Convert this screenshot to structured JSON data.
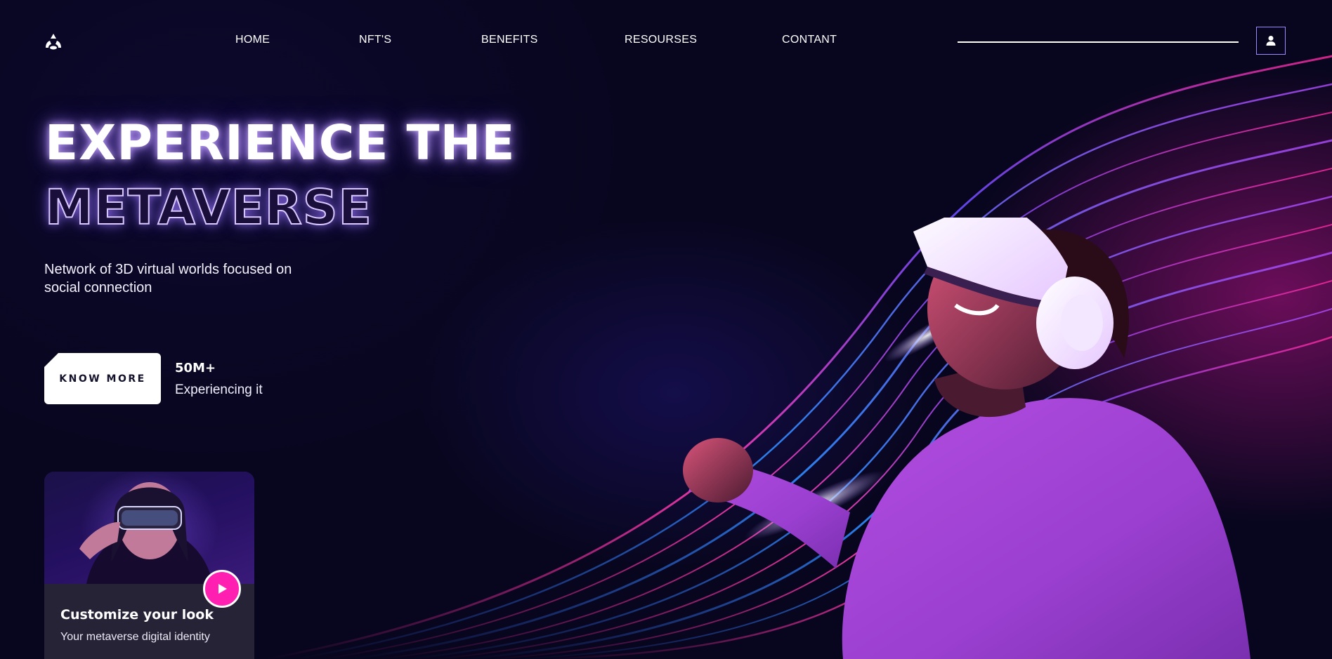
{
  "nav": {
    "items": [
      {
        "label": "HOME"
      },
      {
        "label": "NFT'S"
      },
      {
        "label": "BENEFITS"
      },
      {
        "label": "RESOURSES"
      },
      {
        "label": "CONTANT"
      }
    ],
    "logo_icon": "tri-dot-logo-icon",
    "user_icon": "user-icon"
  },
  "hero": {
    "title_line1": "EXPERIENCE THE",
    "title_line2": "METAVERSE",
    "subtitle": "Network of 3D virtual worlds focused on social connection",
    "cta_label": "KNOW MORE",
    "stat_value": "50M+",
    "stat_label": "Experiencing it"
  },
  "card": {
    "title": "Customize your look",
    "subtitle": "Your metaverse digital identity",
    "play_icon": "play-icon"
  },
  "colors": {
    "background": "#090725",
    "accent_pink": "#ff1fb0",
    "accent_violet": "#9a8cff",
    "card_bg": "#262337"
  }
}
